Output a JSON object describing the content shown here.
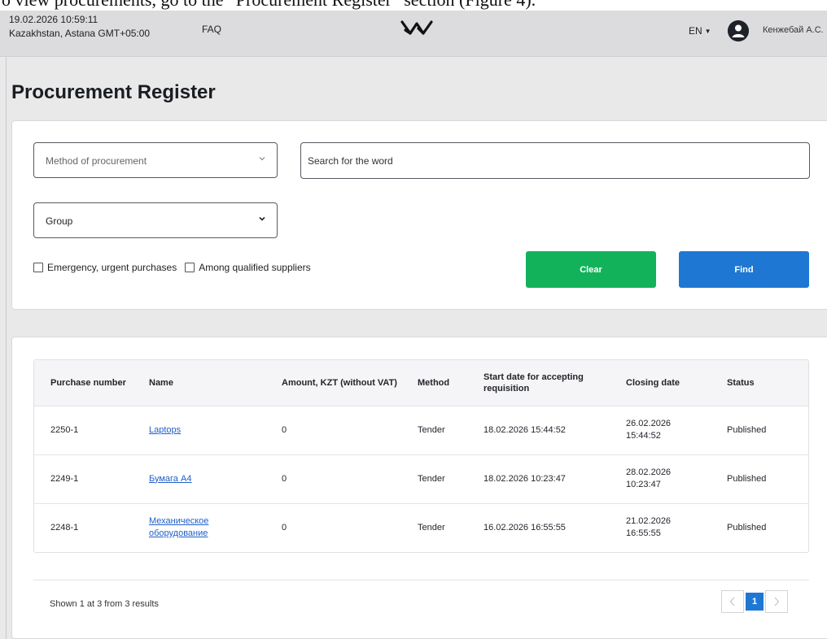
{
  "caption": "o view procurements, go to the “Procurement Register” section (Figure 4).",
  "header": {
    "datetime": "19.02.2026 10:59:11",
    "timezone": "Kazakhstan, Astana GMT+05:00",
    "faq": "FAQ",
    "language": "EN",
    "user": "Кенжебай А.С."
  },
  "page": {
    "title": "Procurement Register"
  },
  "filters": {
    "method_placeholder": "Method of procurement",
    "search_placeholder": "Search for the word",
    "group_value": "Group",
    "checkbox_emergency": "Emergency, urgent purchases",
    "checkbox_qualified": "Among qualified suppliers",
    "clear_label": "Clear",
    "find_label": "Find"
  },
  "table": {
    "headers": {
      "number": "Purchase number",
      "name": "Name",
      "amount": "Amount, KZT (without VAT)",
      "method": "Method",
      "start": "Start date for accepting requisition",
      "closing": "Closing date",
      "status": "Status"
    },
    "rows": [
      {
        "number": "2250-1",
        "name": "Laptops",
        "amount": "0",
        "method": "Tender",
        "start": "18.02.2026 15:44:52",
        "closing": "26.02.2026 15:44:52",
        "status": "Published"
      },
      {
        "number": "2249-1",
        "name": "Бумага А4",
        "amount": "0",
        "method": "Tender",
        "start": "18.02.2026 10:23:47",
        "closing": "28.02.2026 10:23:47",
        "status": "Published"
      },
      {
        "number": "2248-1",
        "name": "Механическое оборудование",
        "amount": "0",
        "method": "Tender",
        "start": "16.02.2026 16:55:55",
        "closing": "21.02.2026 16:55:55",
        "status": "Published"
      }
    ]
  },
  "footer": {
    "summary": "Shown 1 at 3 from 3 results",
    "current_page": "1"
  },
  "colors": {
    "clear_button": "#12b25b",
    "find_button": "#1f77d4",
    "link": "#1f5fc9"
  }
}
